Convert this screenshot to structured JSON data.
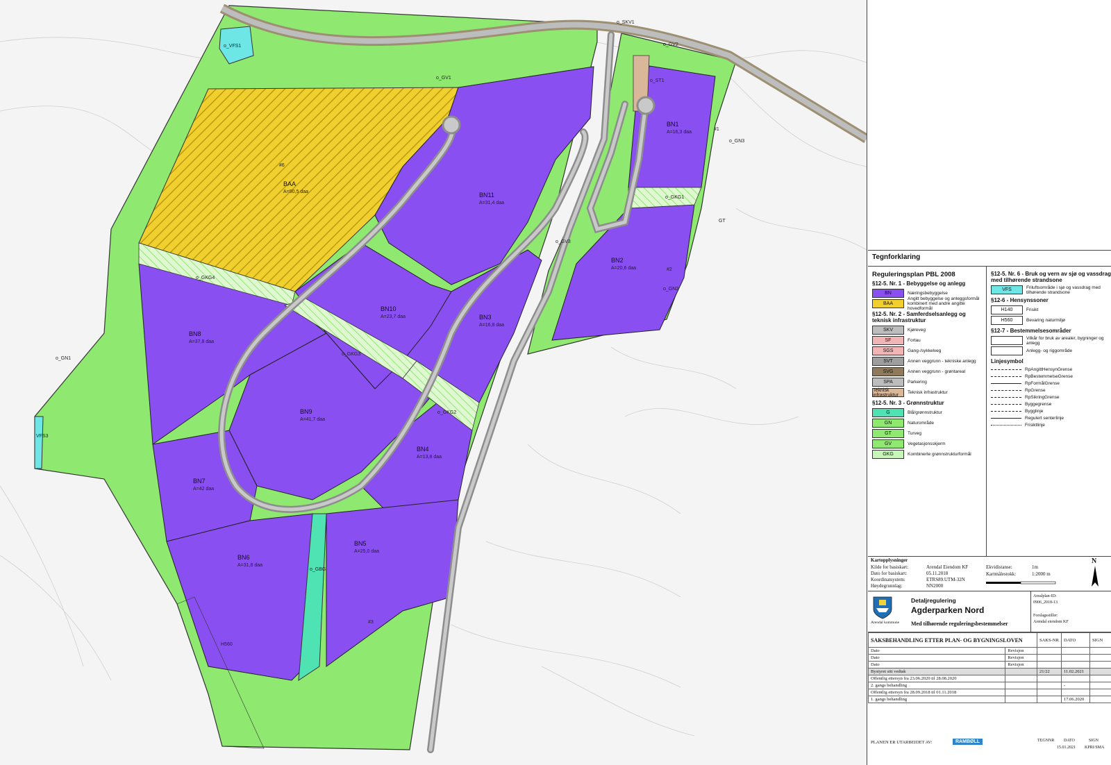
{
  "map": {
    "zones": {
      "bn1": {
        "name": "BN1",
        "desc": "A=16,3 daa"
      },
      "bn2": {
        "name": "BN2",
        "desc": "A=20,6 daa"
      },
      "bn3": {
        "name": "BN3",
        "desc": "A=16,8 daa"
      },
      "bn4": {
        "name": "BN4",
        "desc": "A=13,8 daa"
      },
      "bn5": {
        "name": "BN5",
        "desc": "A=25,0 daa"
      },
      "bn6": {
        "name": "BN6",
        "desc": "A=31,8 daa"
      },
      "bn7": {
        "name": "BN7",
        "desc": "A=42 daa"
      },
      "bn8": {
        "name": "BN8",
        "desc": "A=37,8 daa"
      },
      "bn9": {
        "name": "BN9",
        "desc": "A=41,7 daa"
      },
      "bn10": {
        "name": "BN10",
        "desc": "A=23,7 daa"
      },
      "bn11": {
        "name": "BN11",
        "desc": "A=31,4 daa"
      },
      "baa": {
        "name": "BAA",
        "desc": "A=90,5 daa"
      }
    },
    "labels": {
      "skv1": "o_SKV1",
      "gv1": "o_GV1",
      "gv2": "o_GV2",
      "gv3": "o_GV3",
      "gn1": "o_GN1",
      "gn2": "o_GN2",
      "gn3": "o_GN3",
      "gkg1": "o_GKG1",
      "gkg2": "o_GKG2",
      "gkg3": "o_GKG3",
      "gkg4": "o_GKG4",
      "gbg": "o_GBG",
      "vfs1": "o_VFS1",
      "vfs3": "VFS3",
      "st1": "o_ST1",
      "h560": "H560",
      "n2": "#2",
      "n3": "#3",
      "n6": "#6",
      "n1": "#1",
      "gt": "GT"
    }
  },
  "legend": {
    "title": "Tegnforklaring",
    "plan": "Reguleringsplan PBL 2008",
    "sec1": "§12-5. Nr. 1 - Bebyggelse og anlegg",
    "sec1_items": [
      {
        "code": "BN",
        "label": "Næringsbebyggelse",
        "color": "#8a4ff0"
      },
      {
        "code": "BAA",
        "label": "Angitt bebyggelse og anleggsformål kombinert med andre angitte hovedformål",
        "color": "#f0cf2e"
      }
    ],
    "sec2": "§12-5. Nr. 2 - Samferdselsanlegg og teknisk infrastruktur",
    "sec2_items": [
      {
        "code": "SKV",
        "label": "Kjøreveg",
        "color": "#bdbdbd"
      },
      {
        "code": "SF",
        "label": "Fortau",
        "color": "#f2b5b5"
      },
      {
        "code": "SGS",
        "label": "Gang-/sykkelveg",
        "color": "#f2b5b5"
      },
      {
        "code": "SVT",
        "label": "Annen veggrunn - tekniske anlegg",
        "color": "#9e9e9e"
      },
      {
        "code": "SVG",
        "label": "Annen veggrunn - grøntareal",
        "color": "#8f7b5c"
      },
      {
        "code": "SPA",
        "label": "Parkering",
        "color": "#bdbdbd"
      },
      {
        "code": "Teknisk infrastruktur",
        "label": "Teknisk infrastruktur",
        "color": "#d9b89a"
      }
    ],
    "sec3": "§12-5. Nr. 3 - Grønnstruktur",
    "sec3_items": [
      {
        "code": "G",
        "label": "Blå/grønnstruktur",
        "color": "#4fe2b3"
      },
      {
        "code": "GN",
        "label": "Naturområde",
        "color": "#8fe870"
      },
      {
        "code": "GT",
        "label": "Turveg",
        "color": "#8fe870"
      },
      {
        "code": "GV",
        "label": "Vegetasjonsskjerm",
        "color": "#8fe870"
      },
      {
        "code": "GKG",
        "label": "Kombinerte grønnstrukturformål",
        "color": "#c8f5b8"
      }
    ],
    "sec6": "§12-5. Nr. 6 - Bruk og vern av sjø og vassdrag med tilhørende strandsone",
    "sec6_items": [
      {
        "code": "VFS",
        "label": "Friluftsområde i sjø og vassdrag med tilhørende strandsone",
        "color": "#6fe6e6"
      }
    ],
    "hens": "§12-6 - Hensynssoner",
    "hens_items": [
      {
        "code": "H140",
        "label": "Frisikt"
      },
      {
        "code": "H560",
        "label": "Bevaring naturmiljø"
      }
    ],
    "best": "§12-7 - Bestemmelsesområder",
    "best_items": [
      {
        "code": "",
        "label": "Vilkår for bruk av arealer, bygninger og anlegg"
      },
      {
        "code": "",
        "label": "Anlegg- og riggområde"
      }
    ],
    "linjesymbol": "Linjesymbol",
    "lines": [
      "RpAngittHensynGrense",
      "RpBestemmelseGrense",
      "RpFormålGrense",
      "RpGrense",
      "RpSikringGrense",
      "Byggegrense",
      "Bygglinje",
      "Regulert senterlinje",
      "Frisiktlinje"
    ]
  },
  "kart": {
    "title": "Kartopplysninger",
    "rows": [
      {
        "k": "Kilde for basiskart:",
        "v": "Arendal Eiendom KF"
      },
      {
        "k": "Dato for basiskart:",
        "v": "05.11.2018"
      },
      {
        "k": "Koordinatsystem:",
        "v": "ETRS89.UTM-32N"
      },
      {
        "k": "Høydegrunnlag:",
        "v": "NN2000"
      }
    ],
    "ekv_k": "Ekvidistanse:",
    "ekv_v": "1m",
    "mal_k": "Kartmålestokk:",
    "mal_v": "1:2000 m",
    "north": "N"
  },
  "titleblock": {
    "kommune": "Arendal kommune",
    "t1": "Detaljregulering",
    "t2": "Agderparken Nord",
    "t3": "Med tilhørende reguleringsbestemmelser",
    "arealplan_k": "Arealplan-ID:",
    "arealplan_v": "0906_2018-13",
    "forslag_k": "Forslagsstiller:",
    "forslag_v": "Arendal eiendom KF"
  },
  "case": {
    "header": "SAKSBEHANDLING ETTER PLAN- OG BYGNINGSLOVEN",
    "cols": [
      "SAKS-NR",
      "DATO",
      "SIGN"
    ],
    "rows": [
      {
        "a": "Dato",
        "b": "Revisjon",
        "c": "",
        "d": "",
        "e": ""
      },
      {
        "a": "Dato",
        "b": "Revisjon",
        "c": "",
        "d": "",
        "e": ""
      },
      {
        "a": "Dato",
        "b": "Revisjon",
        "c": "",
        "d": "",
        "e": ""
      },
      {
        "a": "Bystyret sitt vedtak",
        "b": "",
        "c": "21/22",
        "d": "11.02.2021",
        "e": ""
      },
      {
        "a": "Offentlig ettersyn fra 23.06.2020 til 28.08.2020",
        "b": "",
        "c": "",
        "d": "",
        "e": ""
      },
      {
        "a": "2. gangs behandling",
        "b": "",
        "c": "",
        "d": "-",
        "e": ""
      },
      {
        "a": "Offentlig ettersyn fra 28.09.2018 til 01.11.2018",
        "b": "",
        "c": "",
        "d": "",
        "e": ""
      },
      {
        "a": "1. gangs behandling",
        "b": "",
        "c": "",
        "d": "17.06.2020",
        "e": ""
      }
    ]
  },
  "footer": {
    "prepared": "PLANEN ER UTARBEIDET AV:",
    "company": "RAMBØLL",
    "tegnnr": "TEGNNR",
    "dato": "DATO",
    "sign": "SIGN",
    "date_v": "15.01.2021",
    "sign_v": "KPRI/SMA"
  }
}
